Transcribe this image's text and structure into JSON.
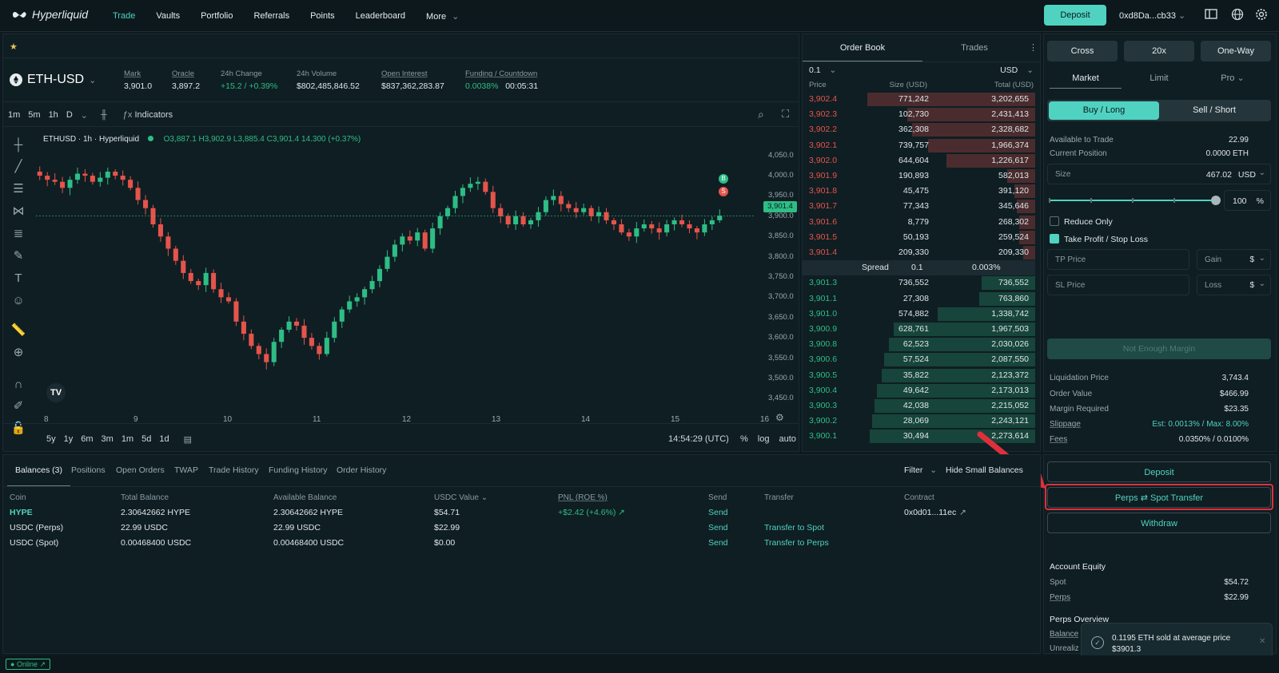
{
  "nav": {
    "brand": "Hyperliquid",
    "links": [
      "Trade",
      "Vaults",
      "Portfolio",
      "Referrals",
      "Points",
      "Leaderboard",
      "More"
    ],
    "active_link": "Trade",
    "deposit_label": "Deposit",
    "wallet": "0xd8Da...cb33"
  },
  "market": {
    "symbol": "ETH-USD",
    "stats": [
      {
        "label": "Mark",
        "value": "3,901.0"
      },
      {
        "label": "Oracle",
        "value": "3,897.2"
      },
      {
        "label": "24h Change",
        "value": "+15.2 / +0.39%"
      },
      {
        "label": "24h Volume",
        "value": "$802,485,846.52"
      },
      {
        "label": "Open Interest",
        "value": "$837,362,283.87"
      },
      {
        "label": "Funding / Countdown",
        "value": "0.0038%",
        "value2": "00:05:31"
      }
    ]
  },
  "chart": {
    "intervals": [
      "1m",
      "5m",
      "1h",
      "D"
    ],
    "indicators_label": "Indicators",
    "legend_title": "ETHUSD · 1h · Hyperliquid",
    "ohlc": {
      "o": "O3,887.1",
      "h": "H3,902.9",
      "l": "L3,885.4",
      "c": "C3,901.4",
      "chg": "14.300 (+0.37%)"
    },
    "ranges": [
      "5y",
      "1y",
      "6m",
      "3m",
      "1m",
      "5d",
      "1d"
    ],
    "time": "14:54:29 (UTC)",
    "scale_opts": [
      "%",
      "log",
      "auto"
    ],
    "price_tag": "3,901.4",
    "markers": [
      "B",
      "S"
    ]
  },
  "chart_data": {
    "type": "candlestick",
    "x_ticks": [
      "8",
      "9",
      "10",
      "11",
      "12",
      "13",
      "14",
      "15",
      "16"
    ],
    "y_ticks": [
      "4,050.0",
      "4,000.0",
      "3,950.0",
      "3,900.0",
      "3,850.0",
      "3,800.0",
      "3,750.0",
      "3,700.0",
      "3,650.0",
      "3,600.0",
      "3,550.0",
      "3,500.0",
      "3,450.0"
    ],
    "ylim": [
      3425,
      4075
    ],
    "closes": [
      4010,
      4000,
      3990,
      3985,
      3970,
      3990,
      4005,
      4000,
      3985,
      3995,
      4010,
      4000,
      3990,
      3970,
      3940,
      3920,
      3880,
      3850,
      3820,
      3790,
      3760,
      3740,
      3730,
      3760,
      3720,
      3700,
      3690,
      3640,
      3610,
      3580,
      3560,
      3540,
      3590,
      3620,
      3640,
      3630,
      3600,
      3580,
      3560,
      3600,
      3640,
      3670,
      3690,
      3700,
      3720,
      3740,
      3770,
      3800,
      3830,
      3850,
      3840,
      3860,
      3820,
      3870,
      3900,
      3920,
      3950,
      3970,
      3980,
      3985,
      3960,
      3920,
      3900,
      3880,
      3900,
      3880,
      3890,
      3910,
      3940,
      3950,
      3930,
      3920,
      3910,
      3920,
      3900,
      3910,
      3890,
      3880,
      3860,
      3850,
      3870,
      3880,
      3870,
      3860,
      3880,
      3890,
      3880,
      3870,
      3860,
      3880,
      3890,
      3901
    ]
  },
  "orderbook": {
    "tabs": [
      "Order Book",
      "Trades"
    ],
    "tick": "0.1",
    "currency": "USD",
    "headers": [
      "Price",
      "Size (USD)",
      "Total (USD)"
    ],
    "asks": [
      {
        "p": "3,902.4",
        "s": "771,242",
        "t": "3,202,655",
        "d": 0.72
      },
      {
        "p": "3,902.3",
        "s": "102,730",
        "t": "2,431,413",
        "d": 0.55
      },
      {
        "p": "3,902.2",
        "s": "362,308",
        "t": "2,328,682",
        "d": 0.53
      },
      {
        "p": "3,902.1",
        "s": "739,757",
        "t": "1,966,374",
        "d": 0.46
      },
      {
        "p": "3,902.0",
        "s": "644,604",
        "t": "1,226,617",
        "d": 0.38
      },
      {
        "p": "3,901.9",
        "s": "190,893",
        "t": "582,013",
        "d": 0.12
      },
      {
        "p": "3,901.8",
        "s": "45,475",
        "t": "391,120",
        "d": 0.09
      },
      {
        "p": "3,901.7",
        "s": "77,343",
        "t": "345,646",
        "d": 0.08
      },
      {
        "p": "3,901.6",
        "s": "8,779",
        "t": "268,302",
        "d": 0.07
      },
      {
        "p": "3,901.5",
        "s": "50,193",
        "t": "259,524",
        "d": 0.07
      },
      {
        "p": "3,901.4",
        "s": "209,330",
        "t": "209,330",
        "d": 0.05
      }
    ],
    "spread": {
      "label": "Spread",
      "value": "0.1",
      "pct": "0.003%"
    },
    "bids": [
      {
        "p": "3,901.3",
        "s": "736,552",
        "t": "736,552",
        "d": 0.23
      },
      {
        "p": "3,901.1",
        "s": "27,308",
        "t": "763,860",
        "d": 0.24
      },
      {
        "p": "3,901.0",
        "s": "574,882",
        "t": "1,338,742",
        "d": 0.42
      },
      {
        "p": "3,900.9",
        "s": "628,761",
        "t": "1,967,503",
        "d": 0.61
      },
      {
        "p": "3,900.8",
        "s": "62,523",
        "t": "2,030,026",
        "d": 0.63
      },
      {
        "p": "3,900.6",
        "s": "57,524",
        "t": "2,087,550",
        "d": 0.65
      },
      {
        "p": "3,900.5",
        "s": "35,822",
        "t": "2,123,372",
        "d": 0.66
      },
      {
        "p": "3,900.4",
        "s": "49,642",
        "t": "2,173,013",
        "d": 0.68
      },
      {
        "p": "3,900.3",
        "s": "42,038",
        "t": "2,215,052",
        "d": 0.69
      },
      {
        "p": "3,900.2",
        "s": "28,069",
        "t": "2,243,121",
        "d": 0.7
      },
      {
        "p": "3,900.1",
        "s": "30,494",
        "t": "2,273,614",
        "d": 0.71
      }
    ]
  },
  "trade": {
    "margin_mode": "Cross",
    "leverage": "20x",
    "position_mode": "One-Way",
    "order_tabs": [
      "Market",
      "Limit",
      "Pro"
    ],
    "buy_label": "Buy / Long",
    "sell_label": "Sell / Short",
    "available_label": "Available to Trade",
    "available_value": "22.99",
    "position_label": "Current Position",
    "position_value": "0.0000 ETH",
    "size_label": "Size",
    "size_value": "467.02",
    "size_unit": "USD",
    "slider_pct": 100,
    "pct_value": "100",
    "pct_sign": "%",
    "reduce_only": "Reduce Only",
    "tpsl": "Take Profit / Stop Loss",
    "tp_price": "TP Price",
    "gain": "Gain",
    "sl_price": "SL Price",
    "loss": "Loss",
    "dollar": "$",
    "submit_label": "Not Enough Margin",
    "info": [
      {
        "label": "Liquidation Price",
        "value": "3,743.4"
      },
      {
        "label": "Order Value",
        "value": "$466.99"
      },
      {
        "label": "Margin Required",
        "value": "$23.35"
      },
      {
        "label": "Slippage",
        "value": "Est: 0.0013% / Max: 8.00%"
      },
      {
        "label": "Fees",
        "value": "0.0350% / 0.0100%"
      }
    ]
  },
  "account": {
    "deposit": "Deposit",
    "transfer_left": "Perps",
    "transfer_right": "Spot Transfer",
    "withdraw": "Withdraw",
    "equity_title": "Account Equity",
    "spot_label": "Spot",
    "spot_value": "$54.72",
    "perps_label": "Perps",
    "perps_value": "$22.99",
    "overview_title": "Perps Overview",
    "balance_label": "Balance",
    "unrealized_label": "Unrealiz"
  },
  "bottom": {
    "tabs": [
      "Balances (3)",
      "Positions",
      "Open Orders",
      "TWAP",
      "Trade History",
      "Funding History",
      "Order History"
    ],
    "filter": "Filter",
    "hide_small": "Hide Small Balances",
    "headers": [
      "Coin",
      "Total Balance",
      "Available Balance",
      "USDC Value",
      "PNL (ROE %)",
      "Send",
      "Transfer",
      "Contract"
    ],
    "rows": [
      {
        "coin": "HYPE",
        "total": "2.30642662 HYPE",
        "avail": "2.30642662 HYPE",
        "usdc": "$54.71",
        "pnl": "+$2.42 (+4.6%)",
        "send": "Send",
        "transfer": "",
        "contract": "0x0d01...11ec"
      },
      {
        "coin": "USDC (Perps)",
        "total": "22.99 USDC",
        "avail": "22.99 USDC",
        "usdc": "$22.99",
        "pnl": "",
        "send": "Send",
        "transfer": "Transfer to Spot",
        "contract": ""
      },
      {
        "coin": "USDC (Spot)",
        "total": "0.00468400 USDC",
        "avail": "0.00468400 USDC",
        "usdc": "$0.00",
        "pnl": "",
        "send": "Send",
        "transfer": "Transfer to Perps",
        "contract": ""
      }
    ]
  },
  "status": {
    "online": "Online"
  },
  "toast": {
    "line1": "0.1195 ETH sold at average price",
    "line2": "$3901.3"
  },
  "colors": {
    "accent": "#50d2c1",
    "bid": "#2ebd85",
    "ask": "#e5544b",
    "highlight": "#e02f3c"
  }
}
